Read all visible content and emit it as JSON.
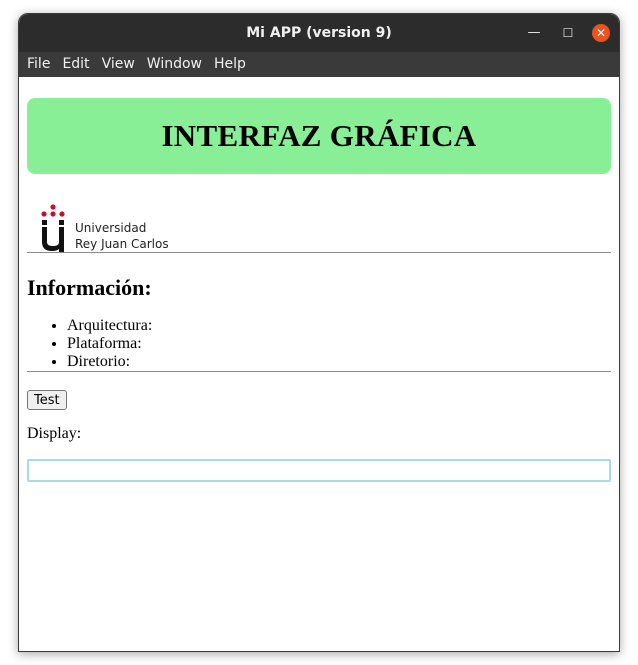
{
  "window": {
    "title": "Mi APP (version 9)",
    "controls": {
      "minimize_glyph": "—",
      "maximize_glyph": "☐",
      "close_glyph": "✕"
    }
  },
  "menubar": {
    "items": [
      "File",
      "Edit",
      "View",
      "Window",
      "Help"
    ]
  },
  "banner": {
    "heading": "INTERFAZ GRÁFICA",
    "color": "#88ef97"
  },
  "logo": {
    "line1": "Universidad",
    "line2": "Rey Juan Carlos",
    "brand_color": "#c8102e"
  },
  "info": {
    "title": "Información:",
    "items": [
      "Arquitectura:",
      "Plataforma:",
      "Diretorio:"
    ]
  },
  "actions": {
    "test_label": "Test"
  },
  "display": {
    "label": "Display:",
    "value": "",
    "border_color": "#add8e6"
  }
}
